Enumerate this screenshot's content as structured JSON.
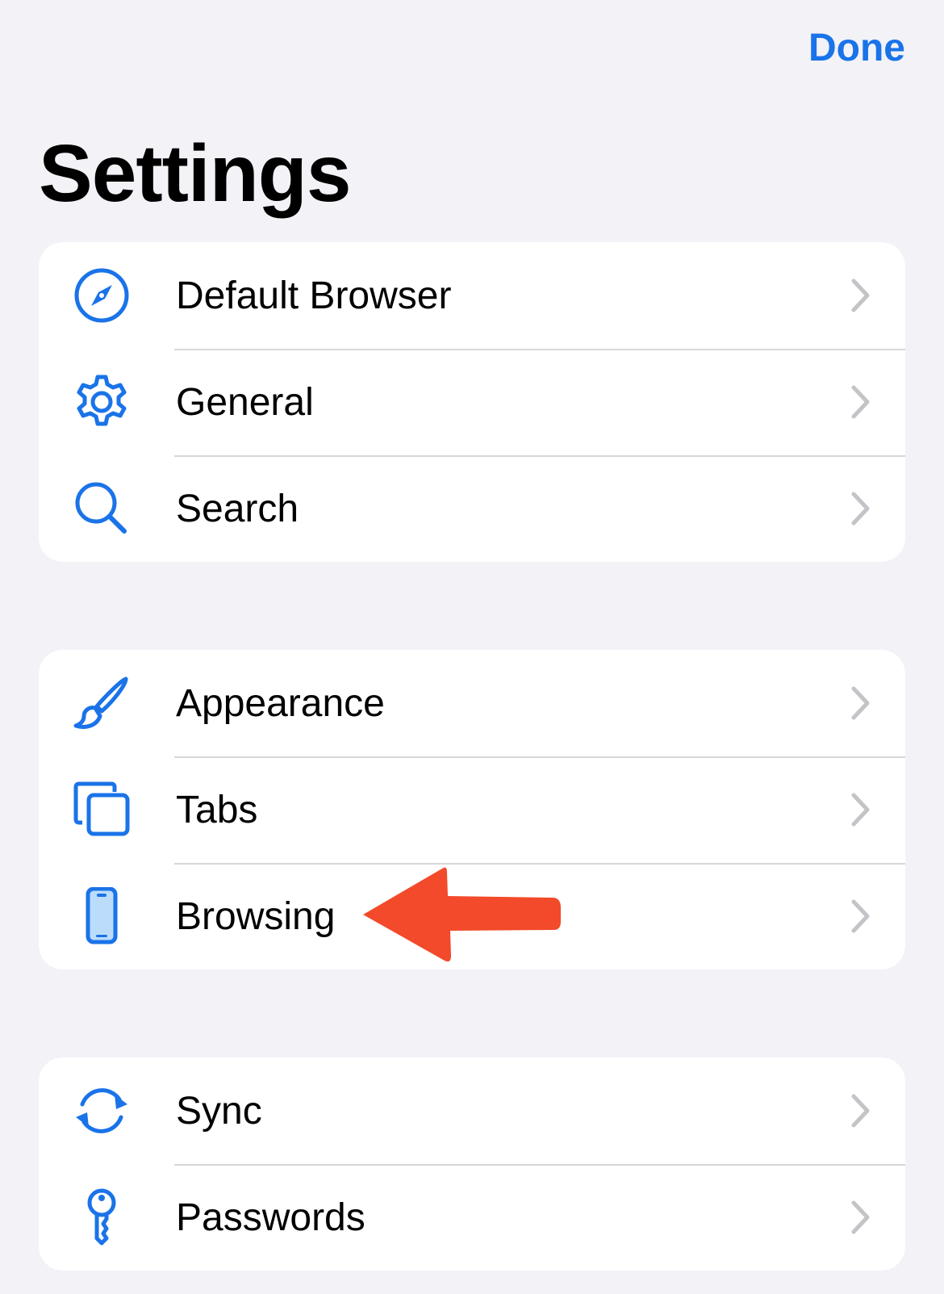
{
  "header": {
    "done_label": "Done",
    "title": "Settings"
  },
  "colors": {
    "accent": "#1a73e8",
    "arrow": "#f24a2a",
    "background": "#f2f2f7"
  },
  "groups": [
    {
      "items": [
        {
          "label": "Default Browser",
          "icon": "compass-icon"
        },
        {
          "label": "General",
          "icon": "gear-icon"
        },
        {
          "label": "Search",
          "icon": "search-icon"
        }
      ]
    },
    {
      "items": [
        {
          "label": "Appearance",
          "icon": "paintbrush-icon"
        },
        {
          "label": "Tabs",
          "icon": "tabs-icon"
        },
        {
          "label": "Browsing",
          "icon": "phone-icon"
        }
      ]
    },
    {
      "items": [
        {
          "label": "Sync",
          "icon": "sync-icon"
        },
        {
          "label": "Passwords",
          "icon": "key-icon"
        }
      ]
    }
  ],
  "annotation": {
    "icon": "arrow-left-icon",
    "points_to": "Browsing"
  }
}
